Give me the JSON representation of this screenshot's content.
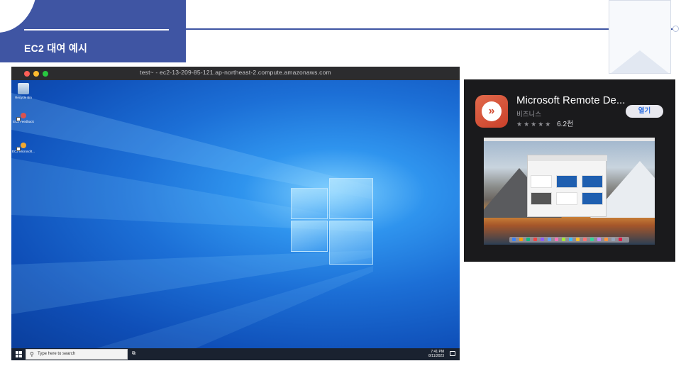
{
  "slide": {
    "title": "EC2 대여 예시"
  },
  "remote_window": {
    "title": "test~ - ec2-13-209-85-121.ap-northeast-2.compute.amazonaws.com",
    "desktop_icons": [
      {
        "label": "Recycle Bin",
        "icon": "recycle-bin-icon"
      },
      {
        "label": "EC2 Feedback",
        "icon": "feedback-shortcut-icon"
      },
      {
        "label": "EC2 Microsoft...",
        "icon": "ec2-shortcut-icon"
      }
    ],
    "taskbar": {
      "search_placeholder": "Type here to search",
      "time": "7:41 PM",
      "date": "8/11/2023"
    }
  },
  "app_store": {
    "app_name": "Microsoft Remote De...",
    "category": "비즈니스",
    "stars": "★★★★★",
    "rating_count": "6.2천",
    "open_button": "열기"
  },
  "colors": {
    "accent": "#3f55a3",
    "card_background": "#1a1a1c",
    "app_icon": "#d2492f",
    "open_button_text": "#2f6fe0"
  }
}
